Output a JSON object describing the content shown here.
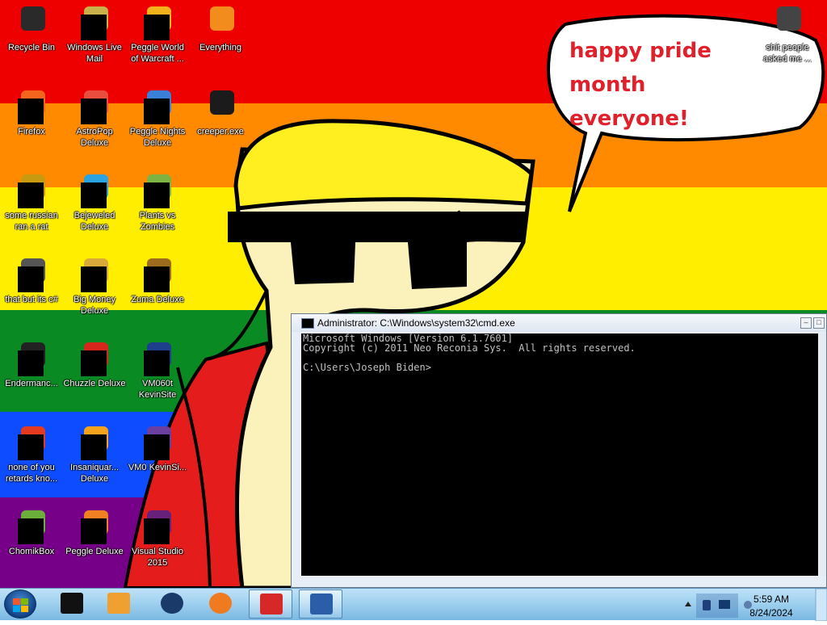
{
  "desktop": {
    "wallpaper": {
      "stripe_colors": [
        "#ee0000",
        "#ff8a00",
        "#ffee00",
        "#0a8a23",
        "#0e4dff",
        "#770088"
      ],
      "speech_text": "happy pride month everyone!",
      "speech_color": "#e0202a"
    },
    "icons": [
      {
        "label": "Recycle Bin",
        "icon": "recycle-bin-icon"
      },
      {
        "label": "Windows Live Mail",
        "icon": "mail-icon"
      },
      {
        "label": "Peggle World of Warcraft ...",
        "icon": "peggle-icon"
      },
      {
        "label": "Everything",
        "icon": "search-icon"
      },
      {
        "label": "Firefox",
        "icon": "firefox-icon"
      },
      {
        "label": "AstroPop Deluxe",
        "icon": "astropop-icon"
      },
      {
        "label": "Peggle Nights Deluxe",
        "icon": "peggle-nights-icon"
      },
      {
        "label": "creeper.exe",
        "icon": "exe-icon"
      },
      {
        "label": "some russian ran a rat",
        "icon": "file-icon"
      },
      {
        "label": "Bejeweled Deluxe",
        "icon": "bejeweled-icon"
      },
      {
        "label": "Plants vs Zombies",
        "icon": "plants-vs-zombies-icon"
      },
      {
        "label": "that but its c#",
        "icon": "shortcut-icon"
      },
      {
        "label": "Big Money Deluxe",
        "icon": "money-bag-icon"
      },
      {
        "label": "Zuma Deluxe",
        "icon": "zuma-icon"
      },
      {
        "label": "Endermanc...",
        "icon": "exe-icon"
      },
      {
        "label": "Chuzzle Deluxe",
        "icon": "chuzzle-icon"
      },
      {
        "label": "VM060t KevinSite",
        "icon": "vm-icon"
      },
      {
        "label": "none of you retards kno...",
        "icon": "file-icon"
      },
      {
        "label": "Insaniquar... Deluxe",
        "icon": "insaniquarium-icon"
      },
      {
        "label": "VM0 KevinSi...",
        "icon": "vm-icon"
      },
      {
        "label": "ChomikBox",
        "icon": "chomikbox-icon"
      },
      {
        "label": "Peggle Deluxe",
        "icon": "peggle-icon"
      },
      {
        "label": "Visual Studio 2015",
        "icon": "visual-studio-icon"
      },
      {
        "label": "shit people asked me ...",
        "icon": "folder-icon"
      }
    ]
  },
  "cmd": {
    "title": "Administrator: C:\\Windows\\system32\\cmd.exe",
    "minimize": "–",
    "maximize": "□",
    "lines": [
      "Microsoft Windows [Version 6.1.7601]",
      "Copyright (c) 2011 Neo Reconia Sys.  All rights reserved.",
      "",
      "C:\\Users\\Joseph Biden>"
    ]
  },
  "taskbar": {
    "start_label": "Start",
    "pinned": [
      {
        "name": "taskbar-app-dark",
        "icon": "monitor-dark-icon"
      },
      {
        "name": "taskbar-app-media",
        "icon": "media-player-icon"
      },
      {
        "name": "taskbar-app-globe",
        "icon": "globe-icon"
      },
      {
        "name": "taskbar-app-firefox",
        "icon": "firefox-icon"
      },
      {
        "name": "taskbar-app-avira",
        "icon": "avira-icon"
      },
      {
        "name": "taskbar-app-cmd",
        "icon": "cmd-icon"
      }
    ],
    "clock": {
      "time": "5:59 AM",
      "date": "8/24/2024"
    }
  }
}
